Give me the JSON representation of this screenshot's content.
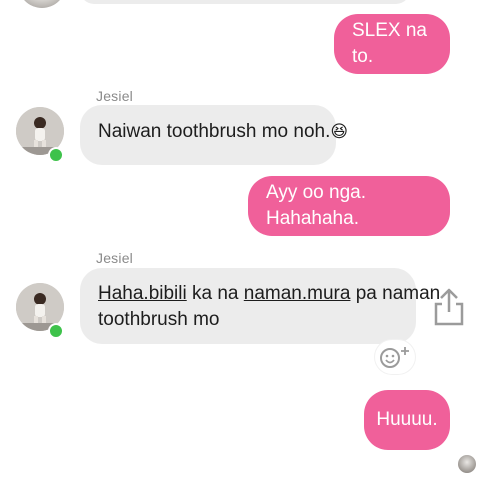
{
  "colors": {
    "outgoing_bubble": "#f0609a",
    "incoming_bubble": "#ececec",
    "online_indicator": "#3ec24b",
    "sender_name": "#8a8a8a"
  },
  "messages": [
    {
      "direction": "outgoing",
      "text": "SLEX na to."
    },
    {
      "direction": "incoming",
      "sender": "Jesiel",
      "text": "Naiwan toothbrush mo noh.",
      "emoji": "😆"
    },
    {
      "direction": "outgoing",
      "text": "Ayy oo nga. Hahahaha."
    },
    {
      "direction": "incoming",
      "sender": "Jesiel",
      "segments": [
        {
          "text": "Haha.bibili",
          "underline": true
        },
        {
          "text": " ka na ",
          "underline": false
        },
        {
          "text": "naman.mura",
          "underline": true
        },
        {
          "text": " pa naman",
          "underline": false
        }
      ],
      "line2": "toothbrush mo"
    },
    {
      "direction": "outgoing",
      "text": "Huuuu."
    }
  ],
  "icons": {
    "share": "share-icon",
    "add_reaction": "add-reaction-icon",
    "avatar": "avatar",
    "read_receipt": "read-receipt-avatar"
  }
}
